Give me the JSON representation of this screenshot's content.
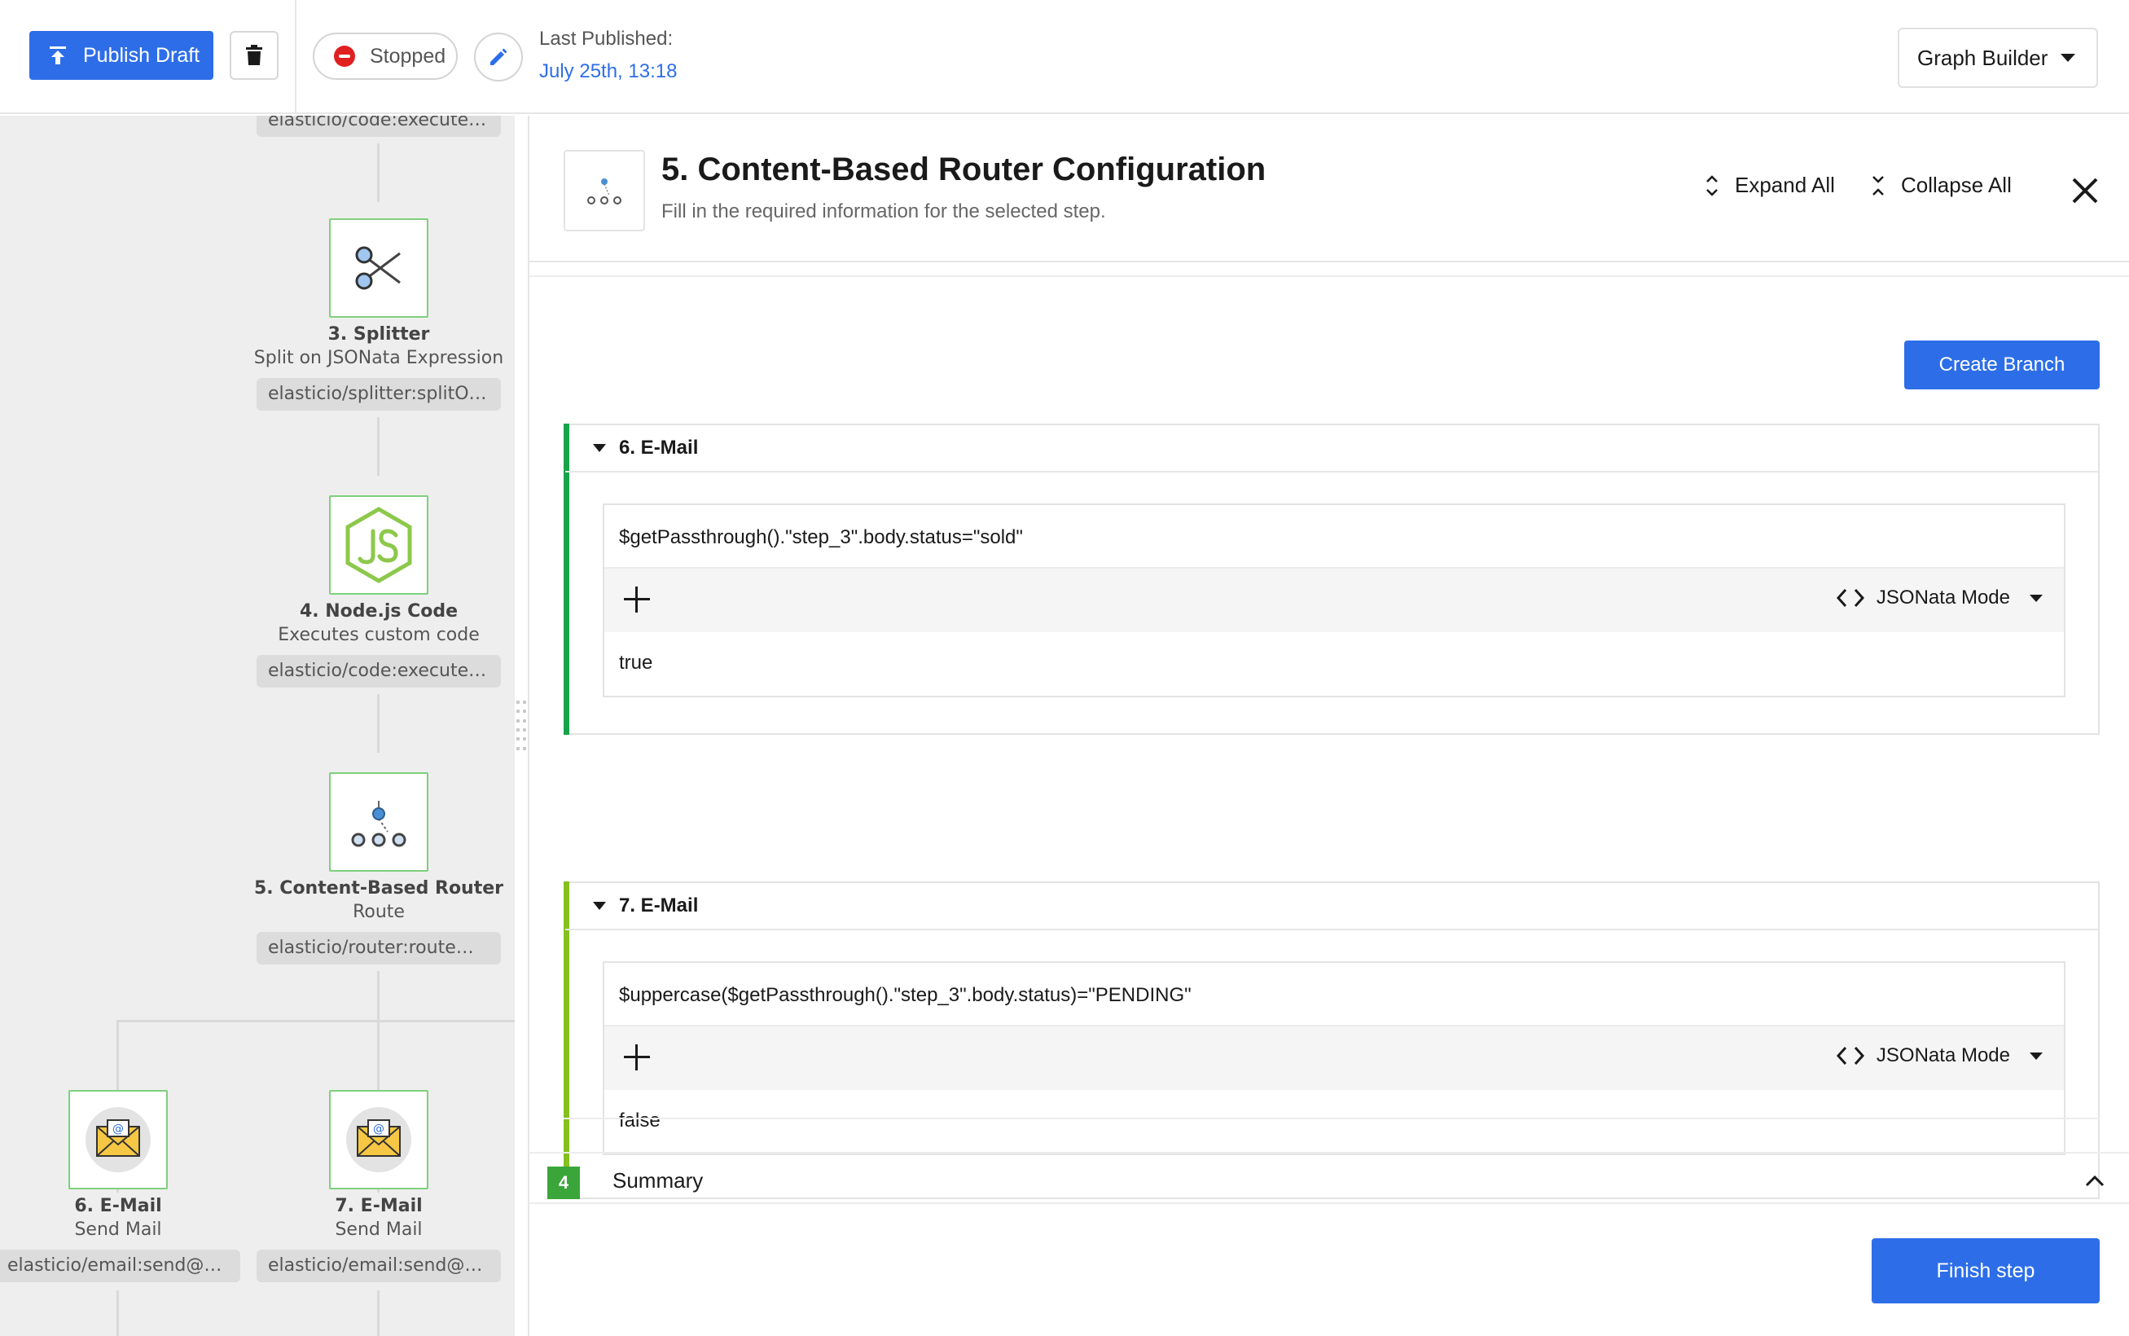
{
  "topbar": {
    "publish_label": "Publish Draft",
    "status_label": "Stopped",
    "last_published_label": "Last Published:",
    "last_published_date": "July 25th, 13:18",
    "view_selector": "Graph Builder"
  },
  "flow": {
    "top_chip": "elasticio/code:execute@...",
    "nodes": [
      {
        "title": "3. Splitter",
        "subtitle": "Split on JSONata Expression",
        "chip": "elasticio/splitter:splitOnJ..."
      },
      {
        "title": "4. Node.js Code",
        "subtitle": "Executes custom code",
        "chip": "elasticio/code:execute@..."
      },
      {
        "title": "5. Content-Based Router",
        "subtitle": "Route",
        "chip": "elasticio/router:route@..."
      },
      {
        "title": "6. E-Mail",
        "subtitle": "Send Mail",
        "chip": "elasticio/email:send@df..."
      },
      {
        "title": "7. E-Mail",
        "subtitle": "Send Mail",
        "chip": "elasticio/email:send@df..."
      }
    ]
  },
  "panel": {
    "title": "5. Content-Based Router Configuration",
    "subtitle": "Fill in the required information for the selected step.",
    "expand_all": "Expand All",
    "collapse_all": "Collapse All",
    "create_branch": "Create Branch",
    "branches": [
      {
        "name": "6. E-Mail",
        "expression": "$getPassthrough().\"step_3\".body.status=\"sold\"",
        "mode": "JSONata Mode",
        "result": "true",
        "accent": "#17a34a"
      },
      {
        "name": "7. E-Mail",
        "expression": "$uppercase($getPassthrough().\"step_3\".body.status)=\"PENDING\"",
        "mode": "JSONata Mode",
        "result": "false",
        "accent": "#84c01e"
      }
    ],
    "summary_number": "4",
    "summary_label": "Summary",
    "finish_step": "Finish step"
  },
  "colors": {
    "primary": "#2d6ee8",
    "node_border": "#7ed07c",
    "stopped": "#e02020",
    "summary_badge": "#3aa63a"
  }
}
